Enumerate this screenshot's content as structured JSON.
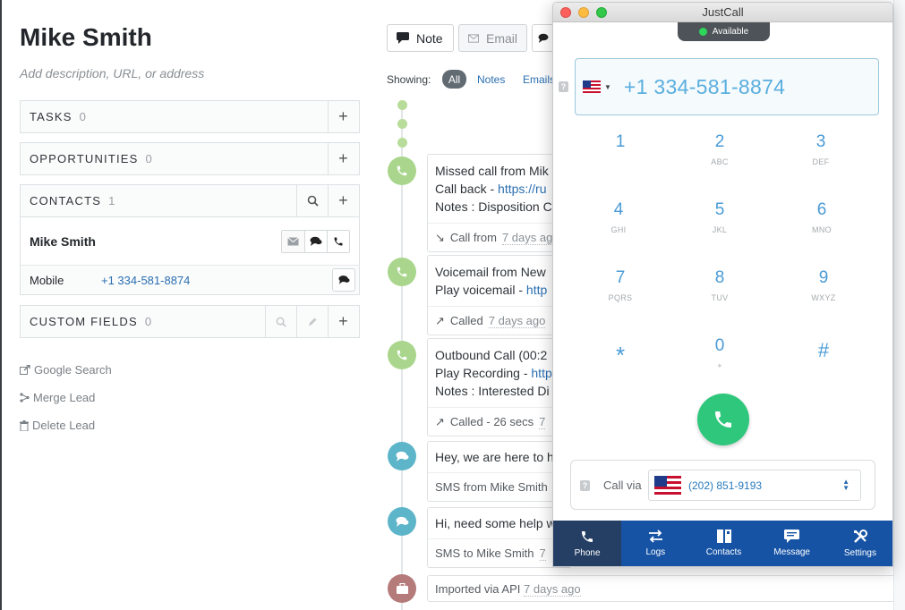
{
  "lead": {
    "name": "Mike Smith",
    "description_placeholder": "Add description, URL, or address"
  },
  "panels": {
    "tasks": {
      "label": "TASKS",
      "count": "0"
    },
    "opportunities": {
      "label": "OPPORTUNITIES",
      "count": "0"
    },
    "contacts": {
      "label": "CONTACTS",
      "count": "1"
    },
    "custom_fields": {
      "label": "CUSTOM FIELDS",
      "count": "0"
    }
  },
  "contact": {
    "name": "Mike Smith",
    "phone_label": "Mobile",
    "phone_number": "+1 334-581-8874"
  },
  "side_links": {
    "google_search": "Google Search",
    "merge_lead": "Merge Lead",
    "delete_lead": "Delete Lead"
  },
  "compose": {
    "note": "Note",
    "email": "Email"
  },
  "filters": {
    "label": "Showing:",
    "all": "All",
    "notes": "Notes",
    "emails": "Emails"
  },
  "timeline": {
    "missed_call": {
      "title": "Missed call from Mik",
      "line2_prefix": "Call back - ",
      "line2_link": "https://ru",
      "line3": "Notes : Disposition C",
      "meta_prefix": "Call from",
      "meta_ago": "7 days ago"
    },
    "voicemail": {
      "title": "Voicemail from New",
      "line2_prefix": "Play voicemail - ",
      "line2_link": "http",
      "meta_prefix": "Called",
      "meta_ago": "7 days ago"
    },
    "outbound": {
      "title": "Outbound Call (00:2",
      "line2_prefix": "Play Recording - ",
      "line2_link": "http",
      "line3": "Notes : Interested Di",
      "meta_prefix": "Called - 26 secs",
      "meta_ago": "7"
    },
    "sms_in": {
      "title": "Hey, we are here to h",
      "meta": "SMS from Mike Smith"
    },
    "sms_out": {
      "title": "Hi, need some help w",
      "meta_prefix": "SMS to Mike Smith",
      "meta_ago": "7"
    },
    "imported": {
      "text": "Imported via API",
      "ago": "7 days ago"
    }
  },
  "justcall": {
    "window_title": "JustCall",
    "status": "Available",
    "dial_number": "+1 334-581-8874",
    "keypad": [
      {
        "digit": "1",
        "letters": ""
      },
      {
        "digit": "2",
        "letters": "ABC"
      },
      {
        "digit": "3",
        "letters": "DEF"
      },
      {
        "digit": "4",
        "letters": "GHI"
      },
      {
        "digit": "5",
        "letters": "JKL"
      },
      {
        "digit": "6",
        "letters": "MNO"
      },
      {
        "digit": "7",
        "letters": "PQRS"
      },
      {
        "digit": "8",
        "letters": "TUV"
      },
      {
        "digit": "9",
        "letters": "WXYZ"
      },
      {
        "digit": "*",
        "letters": ""
      },
      {
        "digit": "0",
        "letters": "+"
      },
      {
        "digit": "#",
        "letters": ""
      }
    ],
    "call_via_label": "Call via",
    "call_via_number": "(202) 851-9193",
    "nav": [
      {
        "label": "Phone",
        "icon": "phone-icon",
        "active": true
      },
      {
        "label": "Logs",
        "icon": "arrows-icon",
        "active": false
      },
      {
        "label": "Contacts",
        "icon": "book-icon",
        "active": false
      },
      {
        "label": "Message",
        "icon": "chat-icon",
        "active": false
      },
      {
        "label": "Settings",
        "icon": "tools-icon",
        "active": false
      }
    ]
  },
  "colors": {
    "accent_blue": "#2a6fb1",
    "call_green": "#2ec77c",
    "nav_blue": "#1653a5",
    "nav_active": "#253f64",
    "timeline_green": "#a9d68c",
    "timeline_teal": "#5db5c9"
  }
}
